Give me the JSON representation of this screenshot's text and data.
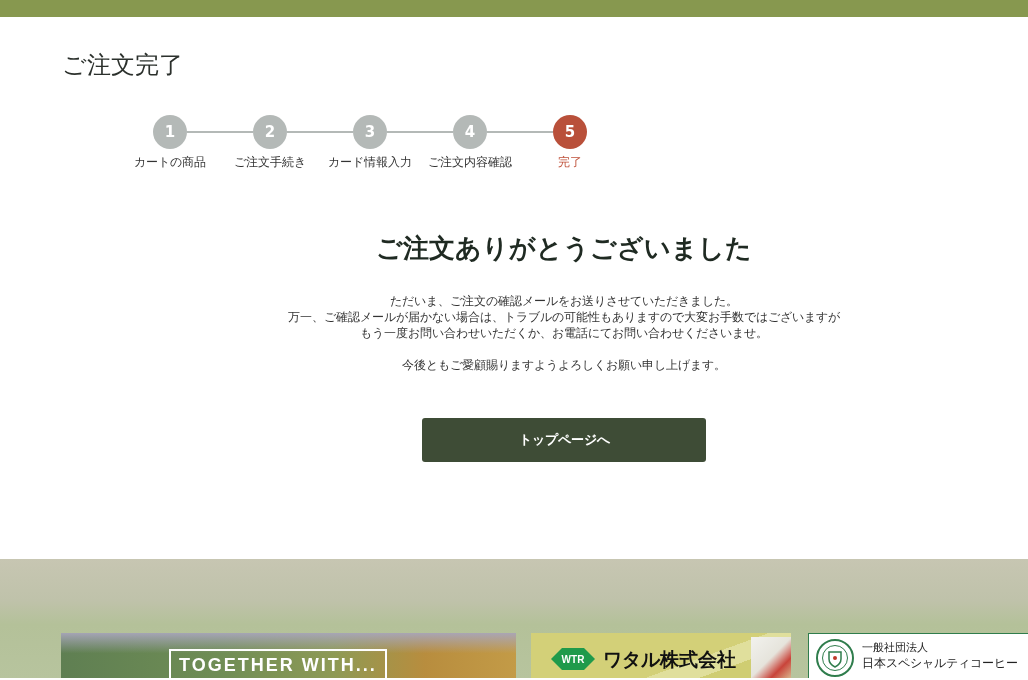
{
  "page_title": "ご注文完了",
  "steps": [
    {
      "number": "1",
      "label": "カートの商品",
      "selected": false
    },
    {
      "number": "2",
      "label": "ご注文手続き",
      "selected": false
    },
    {
      "number": "3",
      "label": "カード情報入力",
      "selected": false
    },
    {
      "number": "4",
      "label": "ご注文内容確認",
      "selected": false
    },
    {
      "number": "5",
      "label": "完了",
      "selected": true
    }
  ],
  "heading": "ご注文ありがとうございました",
  "message": [
    [
      "ただいま、ご注文の確認メールをお送りさせていただきました。",
      "万一、ご確認メールが届かない場合は、トラブルの可能性もありますので大変お手数ではございますが",
      "もう一度お問い合わせいただくか、お電話にてお問い合わせくださいませ。"
    ],
    [
      "今後ともご愛顧賜りますようよろしくお願い申し上げます。"
    ]
  ],
  "button": {
    "label": "トップページへ"
  },
  "footer": {
    "banners": [
      {
        "kind": "photo",
        "caption": "TOGETHER WITH..."
      },
      {
        "kind": "company",
        "mark": "WTR",
        "name": "ワタル株式会社"
      },
      {
        "kind": "association",
        "subtitle": "一般社団法人",
        "name": "日本スペシャルティコーヒー"
      }
    ]
  }
}
